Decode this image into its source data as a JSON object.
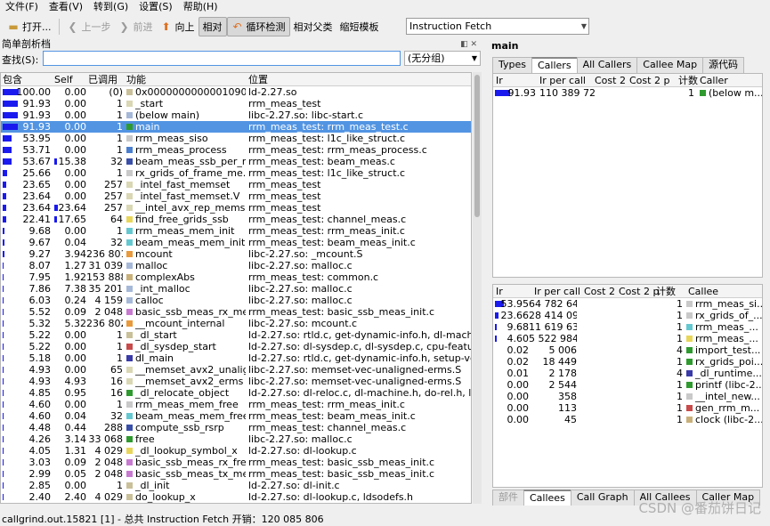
{
  "menu": [
    "文件(F)",
    "查看(V)",
    "转到(G)",
    "设置(S)",
    "帮助(H)"
  ],
  "toolbar": {
    "open": "打开...",
    "back": "上一步",
    "forward": "前进",
    "up": "向上",
    "relative": "相对",
    "cycle": "循环检测",
    "relparent": "相对父类",
    "shorten": "缩短模板",
    "event": "Instruction Fetch"
  },
  "profile": {
    "title": "简单剖析档",
    "find_label": "查找(S):",
    "find_value": "",
    "grouping": "(无分组)",
    "headers": [
      "包含",
      "Self",
      "已调用",
      "功能",
      "位置"
    ],
    "rows": [
      {
        "incl": "100.00",
        "self": "0.00",
        "called": "(0)",
        "func": "0x0000000000001090",
        "loc": "ld-2.27.so",
        "color": "#c9c09a",
        "sel": false,
        "sb": 0
      },
      {
        "incl": "91.93",
        "self": "0.00",
        "called": "1",
        "func": "_start",
        "loc": "rrm_meas_test",
        "color": "#d9d7b4",
        "sel": false,
        "sb": 0
      },
      {
        "incl": "91.93",
        "self": "0.00",
        "called": "1",
        "func": "(below main)",
        "loc": "libc-2.27.so: libc-start.c",
        "color": "#a6b8d8",
        "sel": false,
        "sb": 0
      },
      {
        "incl": "91.93",
        "self": "0.00",
        "called": "1",
        "func": "main",
        "loc": "rrm_meas_test: rrm_meas_test.c",
        "color": "#2f9a2f",
        "sel": true,
        "sb": 0
      },
      {
        "incl": "53.95",
        "self": "0.00",
        "called": "1",
        "func": "rrm_meas_siso",
        "loc": "rrm_meas_test: l1c_like_struct.c",
        "color": "#c9c9c9",
        "sel": false,
        "sb": 0
      },
      {
        "incl": "53.71",
        "self": "0.00",
        "called": "1",
        "func": "rrm_meas_process",
        "loc": "rrm_meas_test: rrm_meas_process.c",
        "color": "#4a7fd0",
        "sel": false,
        "sb": 0
      },
      {
        "incl": "53.67",
        "self": "15.38",
        "called": "32",
        "func": "beam_meas_ssb_per_m...",
        "loc": "rrm_meas_test: beam_meas.c",
        "color": "#3a4fa8",
        "sel": false,
        "sb": 1
      },
      {
        "incl": "25.66",
        "self": "0.00",
        "called": "1",
        "func": "rx_grids_of_frame_me...",
        "loc": "rrm_meas_test: l1c_like_struct.c",
        "color": "#c9c9c9",
        "sel": false,
        "sb": 0
      },
      {
        "incl": "23.65",
        "self": "0.00",
        "called": "257",
        "func": "_intel_fast_memset",
        "loc": "rrm_meas_test",
        "color": "#d9d7b4",
        "sel": false,
        "sb": 0
      },
      {
        "incl": "23.64",
        "self": "0.00",
        "called": "257",
        "func": "_intel_fast_memset.V",
        "loc": "rrm_meas_test",
        "color": "#d9d7b4",
        "sel": false,
        "sb": 0
      },
      {
        "incl": "23.64",
        "self": "23.64",
        "called": "257",
        "func": "__intel_avx_rep_memset",
        "loc": "rrm_meas_test",
        "color": "#d9d7b4",
        "sel": false,
        "sb": 1
      },
      {
        "incl": "22.41",
        "self": "17.65",
        "called": "64",
        "func": "find_free_grids_ssb",
        "loc": "rrm_meas_test: channel_meas.c",
        "color": "#e8d65a",
        "sel": false,
        "sb": 1
      },
      {
        "incl": "9.68",
        "self": "0.00",
        "called": "1",
        "func": "rrm_meas_mem_init",
        "loc": "rrm_meas_test: rrm_meas_init.c",
        "color": "#64c8d0",
        "sel": false,
        "sb": 0
      },
      {
        "incl": "9.67",
        "self": "0.04",
        "called": "32",
        "func": "beam_meas_mem_init",
        "loc": "rrm_meas_test: beam_meas_init.c",
        "color": "#64c8d0",
        "sel": false,
        "sb": 0
      },
      {
        "incl": "9.27",
        "self": "3.94",
        "called": "236 801",
        "func": "mcount",
        "loc": "libc-2.27.so: _mcount.S",
        "color": "#e89a3c",
        "sel": false,
        "sb": 0
      },
      {
        "incl": "8.07",
        "self": "1.27",
        "called": "31 039",
        "func": "malloc",
        "loc": "libc-2.27.so: malloc.c",
        "color": "#a6b8d8",
        "sel": false,
        "sb": 0
      },
      {
        "incl": "7.95",
        "self": "1.92",
        "called": "153 888",
        "func": "complexAbs",
        "loc": "rrm_meas_test: common.c",
        "color": "#c9b07a",
        "sel": false,
        "sb": 0
      },
      {
        "incl": "7.86",
        "self": "7.38",
        "called": "35 201",
        "func": "_int_malloc",
        "loc": "libc-2.27.so: malloc.c",
        "color": "#a6b8d8",
        "sel": false,
        "sb": 0
      },
      {
        "incl": "6.03",
        "self": "0.24",
        "called": "4 159",
        "func": "calloc",
        "loc": "libc-2.27.so: malloc.c",
        "color": "#a6b8d8",
        "sel": false,
        "sb": 0
      },
      {
        "incl": "5.52",
        "self": "0.09",
        "called": "2 048",
        "func": "basic_ssb_meas_rx_me...",
        "loc": "rrm_meas_test: basic_ssb_meas_init.c",
        "color": "#c87ad0",
        "sel": false,
        "sb": 0
      },
      {
        "incl": "5.32",
        "self": "5.32",
        "called": "236 802",
        "func": "__mcount_internal",
        "loc": "libc-2.27.so: mcount.c",
        "color": "#e89a3c",
        "sel": false,
        "sb": 0
      },
      {
        "incl": "5.22",
        "self": "0.00",
        "called": "1",
        "func": "_dl_start",
        "loc": "ld-2.27.so: rtld.c, get-dynamic-info.h, dl-machine.h, ...",
        "color": "#c9c09a",
        "sel": false,
        "sb": 0
      },
      {
        "incl": "5.22",
        "self": "0.00",
        "called": "1",
        "func": "_dl_sysdep_start",
        "loc": "ld-2.27.so: dl-sysdep.c, dl-sysdep.c, cpu-features.c",
        "color": "#c84a4a",
        "sel": false,
        "sb": 0
      },
      {
        "incl": "5.18",
        "self": "0.00",
        "called": "1",
        "func": "dl_main",
        "loc": "ld-2.27.so: rtld.c, get-dynamic-info.h, setup-vdso.h, ...",
        "color": "#3a3aa8",
        "sel": false,
        "sb": 0
      },
      {
        "incl": "4.93",
        "self": "0.00",
        "called": "65",
        "func": "__memset_avx2_unalig...",
        "loc": "libc-2.27.so: memset-vec-unaligned-erms.S",
        "color": "#d9d7b4",
        "sel": false,
        "sb": 0
      },
      {
        "incl": "4.93",
        "self": "4.93",
        "called": "16",
        "func": "__memset_avx2_erms",
        "loc": "libc-2.27.so: memset-vec-unaligned-erms.S",
        "color": "#d9d7b4",
        "sel": false,
        "sb": 0
      },
      {
        "incl": "4.85",
        "self": "0.95",
        "called": "16",
        "func": "_dl_relocate_object",
        "loc": "ld-2.27.so: dl-reloc.c, dl-machine.h, do-rel.h, ldsodef...",
        "color": "#2f9a2f",
        "sel": false,
        "sb": 0
      },
      {
        "incl": "4.60",
        "self": "0.00",
        "called": "1",
        "func": "rrm_meas_mem_free",
        "loc": "rrm_meas_test: rrm_meas_init.c",
        "color": "#c9c9c9",
        "sel": false,
        "sb": 0
      },
      {
        "incl": "4.60",
        "self": "0.04",
        "called": "32",
        "func": "beam_meas_mem_free",
        "loc": "rrm_meas_test: beam_meas_init.c",
        "color": "#64c8d0",
        "sel": false,
        "sb": 0
      },
      {
        "incl": "4.48",
        "self": "0.44",
        "called": "288",
        "func": "compute_ssb_rsrp",
        "loc": "rrm_meas_test: channel_meas.c",
        "color": "#3a4fa8",
        "sel": false,
        "sb": 0
      },
      {
        "incl": "4.26",
        "self": "3.14",
        "called": "33 068",
        "func": "free",
        "loc": "libc-2.27.so: malloc.c",
        "color": "#2f9a2f",
        "sel": false,
        "sb": 0
      },
      {
        "incl": "4.05",
        "self": "1.31",
        "called": "4 029",
        "func": "_dl_lookup_symbol_x",
        "loc": "ld-2.27.so: dl-lookup.c",
        "color": "#e8d65a",
        "sel": false,
        "sb": 0
      },
      {
        "incl": "3.03",
        "self": "0.09",
        "called": "2 048",
        "func": "basic_ssb_meas_rx_free",
        "loc": "rrm_meas_test: basic_ssb_meas_init.c",
        "color": "#c87ad0",
        "sel": false,
        "sb": 0
      },
      {
        "incl": "2.99",
        "self": "0.05",
        "called": "2 048",
        "func": "basic_ssb_meas_tx_me...",
        "loc": "rrm_meas_test: basic_ssb_meas_init.c",
        "color": "#c87ad0",
        "sel": false,
        "sb": 0
      },
      {
        "incl": "2.85",
        "self": "0.00",
        "called": "1",
        "func": "_dl_init",
        "loc": "ld-2.27.so: dl-init.c",
        "color": "#c9c09a",
        "sel": false,
        "sb": 0
      },
      {
        "incl": "2.40",
        "self": "2.40",
        "called": "4 029",
        "func": "do_lookup_x",
        "loc": "ld-2.27.so: dl-lookup.c, ldsodefs.h",
        "color": "#c9c09a",
        "sel": false,
        "sb": 0
      }
    ]
  },
  "right": {
    "title": "main",
    "top_tabs": [
      "Types",
      "Callers",
      "All Callers",
      "Callee Map",
      "源代码"
    ],
    "callers_headers": [
      "Ir",
      "Ir per call",
      "Cost 2",
      "Cost 2 p",
      "计数",
      "Caller"
    ],
    "callers": [
      {
        "ir": "91.93",
        "ipc": "110 389 729",
        "count": "1",
        "name": "(below m...",
        "color": "#2f9a2f"
      }
    ],
    "bottom_tabs": [
      "部件",
      "Callees",
      "Call Graph",
      "All Callees",
      "Caller Map"
    ],
    "callees_headers": [
      "Ir",
      "Ir per call",
      "Cost 2",
      "Cost 2 p",
      "计数",
      "Callee"
    ],
    "callees": [
      {
        "ir": "53.95",
        "ipc": "64 782 641",
        "count": "1",
        "name": "rrm_meas_si...",
        "color": "#c9c9c9",
        "w": 1
      },
      {
        "ir": "23.66",
        "ipc": "28 414 092",
        "count": "1",
        "name": "rx_grids_of_...",
        "color": "#c9c9c9",
        "w": 1
      },
      {
        "ir": "9.68",
        "ipc": "11 619 638",
        "count": "1",
        "name": "rrm_meas_...",
        "color": "#64c8d0",
        "w": 1
      },
      {
        "ir": "4.60",
        "ipc": "5 522 984",
        "count": "1",
        "name": "rrm_meas_...",
        "color": "#e8d65a",
        "w": 0
      },
      {
        "ir": "0.02",
        "ipc": "5 006",
        "count": "4",
        "name": "import_test...",
        "color": "#2f9a2f",
        "w": 0
      },
      {
        "ir": "0.02",
        "ipc": "18 449",
        "count": "1",
        "name": "rx_grids_poi...",
        "color": "#2f9a2f",
        "w": 0
      },
      {
        "ir": "0.01",
        "ipc": "2 178",
        "count": "4",
        "name": "_dl_runtime...",
        "color": "#3a3aa8",
        "w": 0
      },
      {
        "ir": "0.00",
        "ipc": "2 544",
        "count": "1",
        "name": "printf (libc-2...",
        "color": "#2f9a2f",
        "w": 0
      },
      {
        "ir": "0.00",
        "ipc": "358",
        "count": "1",
        "name": "__intel_new...",
        "color": "#c9c9c9",
        "w": 0
      },
      {
        "ir": "0.00",
        "ipc": "113",
        "count": "1",
        "name": "gen_rrm_m...",
        "color": "#c84a4a",
        "w": 0
      },
      {
        "ir": "0.00",
        "ipc": "45",
        "count": "1",
        "name": "clock (libc-2...",
        "color": "#c9b07a",
        "w": 0
      }
    ]
  },
  "status": "callgrind.out.15821 [1] - 总共 Instruction Fetch 开销：120 085 806",
  "watermark": "CSDN @番茄饼日记"
}
